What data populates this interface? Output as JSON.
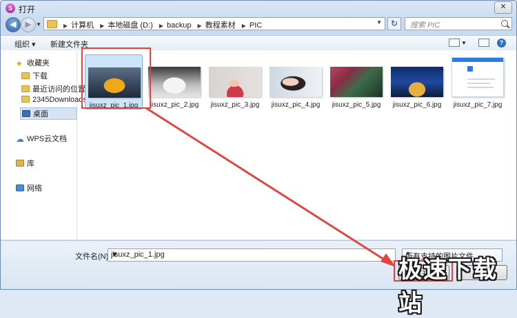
{
  "window": {
    "title": "打开",
    "app_icon_letter": "S",
    "close_glyph": "✕"
  },
  "nav": {
    "back_glyph": "◀",
    "forward_glyph": "▶"
  },
  "breadcrumbs": [
    "计算机",
    "本地磁盘 (D:)",
    "backup",
    "教程素材",
    "PIC"
  ],
  "search": {
    "placeholder": "搜索 PIC"
  },
  "toolbar": {
    "organize": "组织 ▾",
    "new_folder": "新建文件夹"
  },
  "sidebar": {
    "favorites": "收藏夹",
    "items": [
      {
        "label": "下载",
        "icon": "download-folder-icon"
      },
      {
        "label": "最近访问的位置",
        "icon": "recent-places-icon"
      },
      {
        "label": "2345Downloads",
        "icon": "folder-icon"
      },
      {
        "label": "桌面",
        "icon": "desktop-icon"
      }
    ],
    "wps": "WPS云文档",
    "library": "库",
    "network": "网络"
  },
  "files": [
    {
      "name": "jisuxz_pic_1.jpg",
      "selected": true
    },
    {
      "name": "jisuxz_pic_2.jpg",
      "selected": false
    },
    {
      "name": "jisuxz_pic_3.jpg",
      "selected": false
    },
    {
      "name": "jisuxz_pic_4.jpg",
      "selected": false
    },
    {
      "name": "jisuxz_pic_5.jpg",
      "selected": false
    },
    {
      "name": "jisuxz_pic_6.jpg",
      "selected": false
    },
    {
      "name": "jisuxz_pic_7.jpg",
      "selected": false
    }
  ],
  "bottom": {
    "filename_label": "文件名(N):",
    "filename_value": "jisuxz_pic_1.jpg",
    "filter_value": "所有支持的图片文件",
    "open_label": "打开",
    "cancel_label": "取消"
  },
  "watermark": "极速下载站",
  "colors": {
    "highlight": "#e0463f",
    "selection": "#cde4fb"
  }
}
